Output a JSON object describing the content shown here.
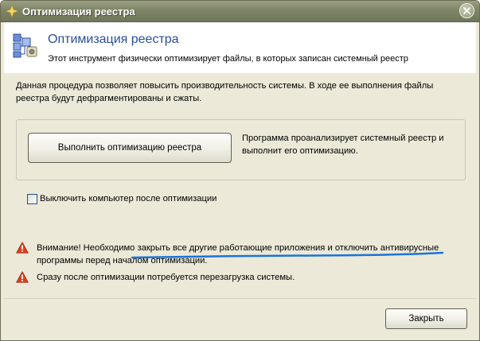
{
  "window": {
    "title": "Оптимизация реестра"
  },
  "header": {
    "title": "Оптимизация реестра",
    "subtitle": "Этот инструмент физически оптимизирует файлы, в которых записан системный реестр"
  },
  "description": "Данная процедура позволяет повысить производительность системы. В ходе ее выполнения файлы реестра будут дефрагментированы и сжаты.",
  "action": {
    "button_label": "Выполнить оптимизацию реестра",
    "button_description": "Программа проанализирует системный реестр и выполнит его оптимизацию."
  },
  "shutdown_option": {
    "label": "Выключить компьютер после оптимизации",
    "checked": false
  },
  "warnings": [
    {
      "icon": "warning-icon",
      "text": "Внимание! Необходимо закрыть все другие работающие приложения и отключить антивирусные программы перед началом оптимизации."
    },
    {
      "icon": "warning-icon",
      "text": "Сразу после оптимизации потребуется перезагрузка системы."
    }
  ],
  "footer": {
    "close_label": "Закрыть"
  },
  "colors": {
    "titlebar": "#7e8466",
    "window_bg": "#ece9d8",
    "header_title": "#2a4e9a",
    "warning": "#d93a1e",
    "annotation_underline": "#1a73d9"
  }
}
